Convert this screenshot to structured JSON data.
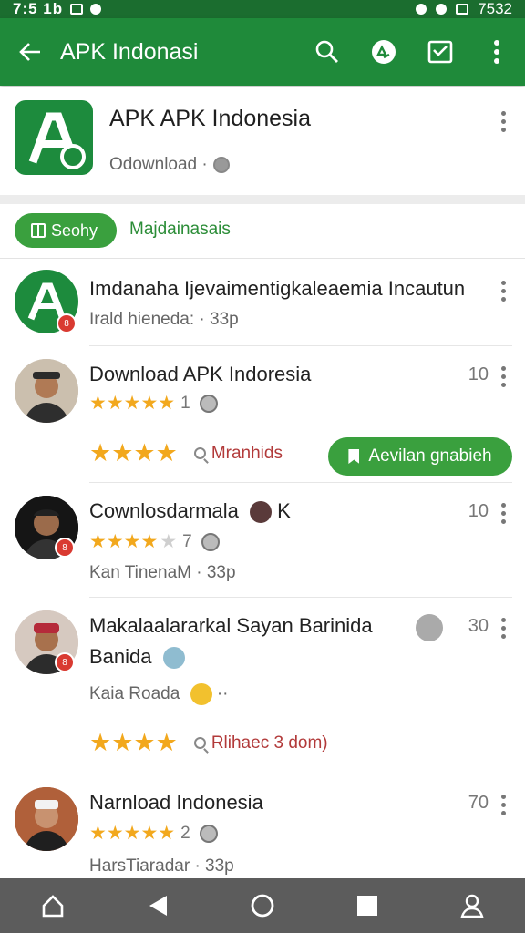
{
  "status_bar": {
    "time": "7:5 1b",
    "battery": "7532"
  },
  "app_bar": {
    "title": "APK Indonasi",
    "icons": [
      "back-arrow-icon",
      "search-icon",
      "recycle-icon",
      "inbox-icon",
      "overflow-menu-icon"
    ]
  },
  "app_header": {
    "name": "APK APK Indonesia",
    "subtitle": "Odownload ·"
  },
  "filter": {
    "chip_label": "Seohy",
    "link_text": "Majdainasais"
  },
  "rows": [
    {
      "title": "Imdanaha Ijevaimentigkaleaemia Incautun",
      "subtitle": "Irald hieneda: · 33p",
      "number": ""
    },
    {
      "title": "Download APK Indoresia",
      "rating_count": "1",
      "number": "10",
      "stars": 5,
      "search_text": "Mranhids",
      "button_label": "Aevilan gnabieh"
    },
    {
      "title": "Cownlosdarmala",
      "title_suffix": "K",
      "rating_count": "7",
      "number": "10",
      "stars": 4.5,
      "subtitle": "Kan TinenaM · 33p"
    },
    {
      "title": "Makalaalararkal Sayan Barinida",
      "title_line2": "Banida",
      "number": "30",
      "subtitle": "Kaia Roada",
      "subtitle_suffix": "··",
      "stars": 4,
      "search_text": "Rlihaec 3 dom)"
    },
    {
      "title": "Narnload Indonesia",
      "rating_count": "2",
      "number": "70",
      "stars": 5,
      "subtitle": "HarsTiaradar · 33p"
    }
  ],
  "colors": {
    "primary": "#1f8a3a",
    "status": "#1b6d2f",
    "accent": "#3aa03e",
    "star": "#f2a81d",
    "navbar": "#5c5c5c"
  }
}
